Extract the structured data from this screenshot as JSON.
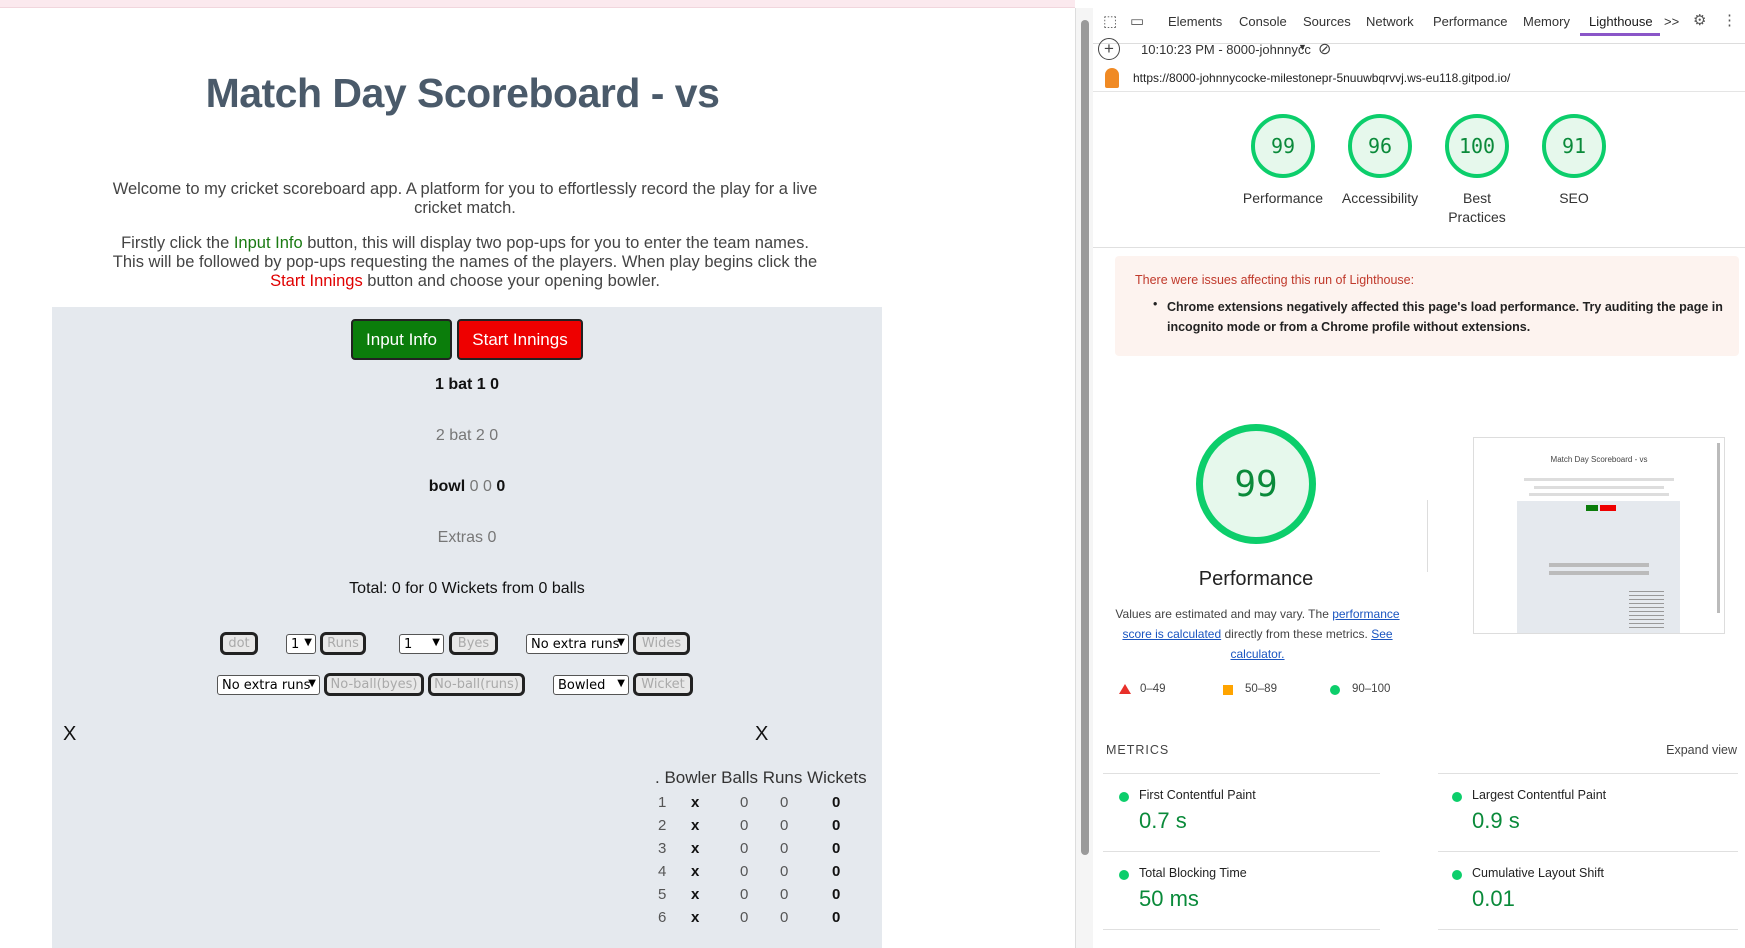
{
  "page": {
    "title": "Match Day Scoreboard -  vs",
    "intro1": "Welcome to my cricket scoreboard app. A platform for you to effortlessly record the play for a live cricket match.",
    "intro2_a": "Firstly click the ",
    "intro2_input": "Input Info",
    "intro2_b": " button, this will display two pop-ups for you to enter the team names. This will be followed by pop-ups requesting the names of the players. When play begins click the ",
    "intro2_start": "Start Innings",
    "intro2_c": " button and choose your opening bowler.",
    "buttons": {
      "input_info": "Input Info",
      "start_innings": "Start Innings"
    },
    "bat1": "1 bat 1 0",
    "bat2": "2 bat 2 0",
    "bowl_label": "bowl",
    "bowl_vals": "0 0",
    "bowl_last": "0",
    "extras": "Extras 0",
    "total": "Total: 0 for 0 Wickets from 0 balls",
    "controls": {
      "dot": "dot",
      "runs_select": "1",
      "runs": "Runs",
      "byes_select": "1",
      "byes": "Byes",
      "wides_select": "No extra runs",
      "wides": "Wides",
      "nb_select": "No extra runs",
      "nb_byes": "No-ball(byes)",
      "nb_runs": "No-ball(runs)",
      "wicket_select": "Bowled",
      "wicket": "Wicket"
    },
    "x_left": "X",
    "x_right": "X",
    "bowler_table": {
      "header": ". Bowler Balls Runs Wickets",
      "rows": [
        {
          "n": "1",
          "bowler": "x",
          "balls": "0",
          "runs": "0",
          "wkts": "0"
        },
        {
          "n": "2",
          "bowler": "x",
          "balls": "0",
          "runs": "0",
          "wkts": "0"
        },
        {
          "n": "3",
          "bowler": "x",
          "balls": "0",
          "runs": "0",
          "wkts": "0"
        },
        {
          "n": "4",
          "bowler": "x",
          "balls": "0",
          "runs": "0",
          "wkts": "0"
        },
        {
          "n": "5",
          "bowler": "x",
          "balls": "0",
          "runs": "0",
          "wkts": "0"
        },
        {
          "n": "6",
          "bowler": "x",
          "balls": "0",
          "runs": "0",
          "wkts": "0"
        }
      ]
    }
  },
  "devtools": {
    "tabs": [
      "Elements",
      "Console",
      "Sources",
      "Network",
      "Performance",
      "Memory",
      "Lighthouse"
    ],
    "active_tab": "Lighthouse",
    "more": ">>",
    "report_time": "10:10:23 PM - 8000-johnnycc",
    "url": "https://8000-johnnycocke-milestonepr-5nuuwbqrvvj.ws-eu118.gitpod.io/",
    "scores": [
      {
        "value": "99",
        "label": "Performance"
      },
      {
        "value": "96",
        "label": "Accessibility"
      },
      {
        "value": "100",
        "label": "Best Practices"
      },
      {
        "value": "91",
        "label": "SEO"
      }
    ],
    "warning_title": "There were issues affecting this run of Lighthouse:",
    "warning_item": "Chrome extensions negatively affected this page's load performance. Try auditing the page in incognito mode or from a Chrome profile without extensions.",
    "perf_score": "99",
    "perf_label": "Performance",
    "perf_desc_a": "Values are estimated and may vary. The ",
    "perf_link1": "performance score is calculated",
    "perf_desc_b": " directly from these metrics. ",
    "perf_link2": "See calculator.",
    "legend": [
      "0–49",
      "50–89",
      "90–100"
    ],
    "metrics_title": "METRICS",
    "expand_view": "Expand view",
    "metrics": [
      {
        "name": "First Contentful Paint",
        "value": "0.7 s"
      },
      {
        "name": "Largest Contentful Paint",
        "value": "0.9 s"
      },
      {
        "name": "Total Blocking Time",
        "value": "50 ms"
      },
      {
        "name": "Cumulative Layout Shift",
        "value": "0.01"
      }
    ],
    "thumbnail": {
      "title": "Match Day Scoreboard -  vs"
    },
    "colors": {
      "pass": "#0cce6b",
      "average": "#ffa400",
      "fail": "#e8302a",
      "accent": "#8a56c8"
    }
  }
}
